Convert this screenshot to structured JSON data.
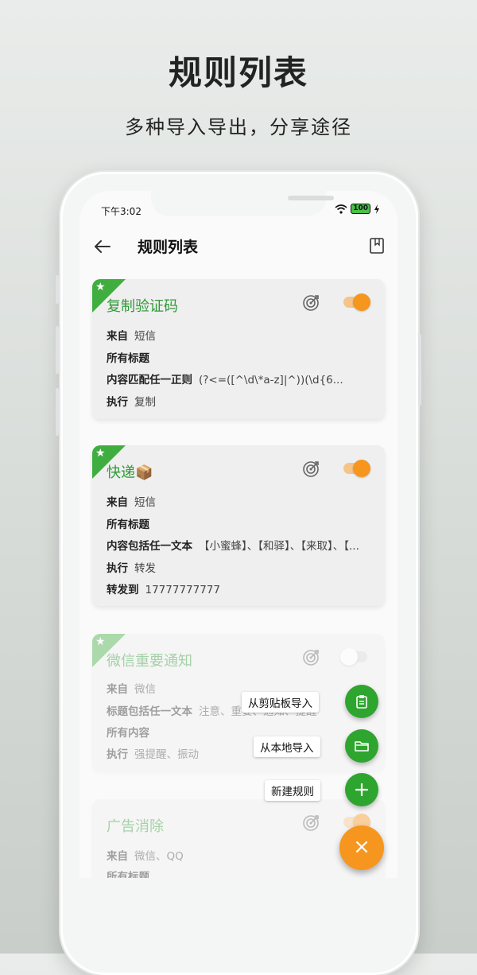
{
  "headline": {
    "title": "规则列表",
    "subtitle": "多种导入导出，分享途径"
  },
  "status": {
    "time": "下午3:02",
    "battery": "100"
  },
  "appbar": {
    "title": "规则列表"
  },
  "cards": [
    {
      "title": "复制验证码",
      "enabled": true,
      "rows": [
        {
          "k": "来自",
          "v": "短信"
        },
        {
          "k": "所有标题",
          "v": ""
        },
        {
          "k": "内容匹配任一正则",
          "v": "(?<=([^\\d\\*a-z]|^))(\\d{6..."
        },
        {
          "k": "执行",
          "v": "复制"
        }
      ]
    },
    {
      "title": "快递📦",
      "enabled": true,
      "rows": [
        {
          "k": "来自",
          "v": "短信"
        },
        {
          "k": "所有标题",
          "v": ""
        },
        {
          "k": "内容包括任一文本",
          "v": "【小蜜蜂】、【和驿】、【来取】、【..."
        },
        {
          "k": "执行",
          "v": "转发"
        },
        {
          "k": "转发到",
          "v": "17777777777"
        }
      ]
    },
    {
      "title": "微信重要通知",
      "enabled": false,
      "rows": [
        {
          "k": "来自",
          "v": "微信"
        },
        {
          "k": "标题包括任一文本",
          "v": "注意、重要、通知、提醒"
        },
        {
          "k": "所有内容",
          "v": ""
        },
        {
          "k": "执行",
          "v": "强提醒、振动"
        }
      ]
    },
    {
      "title": "广告消除",
      "enabled": true,
      "rows": [
        {
          "k": "来自",
          "v": "微信、QQ"
        },
        {
          "k": "所有标题",
          "v": ""
        }
      ]
    }
  ],
  "fab": {
    "clipboard_import": "从剪贴板导入",
    "local_import": "从本地导入",
    "new_rule": "新建规则",
    "close": "×"
  },
  "colors": {
    "accent_green": "#2ea52e",
    "accent_orange": "#f6961e"
  }
}
